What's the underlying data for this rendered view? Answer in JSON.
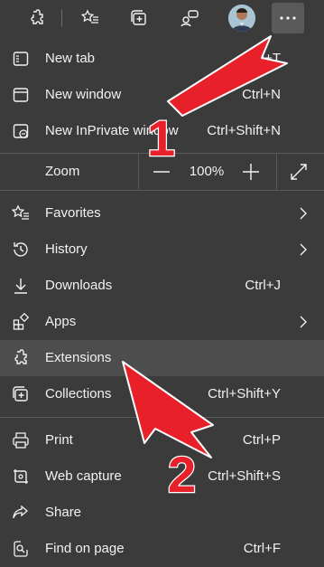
{
  "toolbar": {
    "buttons": [
      "extensions-puzzle",
      "favorites-star",
      "collections",
      "feedback"
    ],
    "more_label": "..."
  },
  "menu": {
    "items_top": [
      {
        "label": "New tab",
        "shortcut": "Ctrl+T"
      },
      {
        "label": "New window",
        "shortcut": "Ctrl+N"
      },
      {
        "label": "New InPrivate window",
        "shortcut": "Ctrl+Shift+N"
      }
    ],
    "zoom": {
      "label": "Zoom",
      "value": "100%",
      "minus": "—",
      "plus": "+"
    },
    "items_mid": [
      {
        "label": "Favorites",
        "shortcut": ""
      },
      {
        "label": "History",
        "shortcut": ""
      },
      {
        "label": "Downloads",
        "shortcut": "Ctrl+J"
      },
      {
        "label": "Apps",
        "shortcut": ""
      },
      {
        "label": "Extensions",
        "shortcut": ""
      },
      {
        "label": "Collections",
        "shortcut": "Ctrl+Shift+Y"
      }
    ],
    "items_bottom": [
      {
        "label": "Print",
        "shortcut": "Ctrl+P"
      },
      {
        "label": "Web capture",
        "shortcut": "Ctrl+Shift+S"
      },
      {
        "label": "Share",
        "shortcut": ""
      },
      {
        "label": "Find on page",
        "shortcut": "Ctrl+F"
      }
    ]
  },
  "annotations": {
    "label_1": "1",
    "label_2": "2",
    "arrow_color": "#e8202a"
  }
}
